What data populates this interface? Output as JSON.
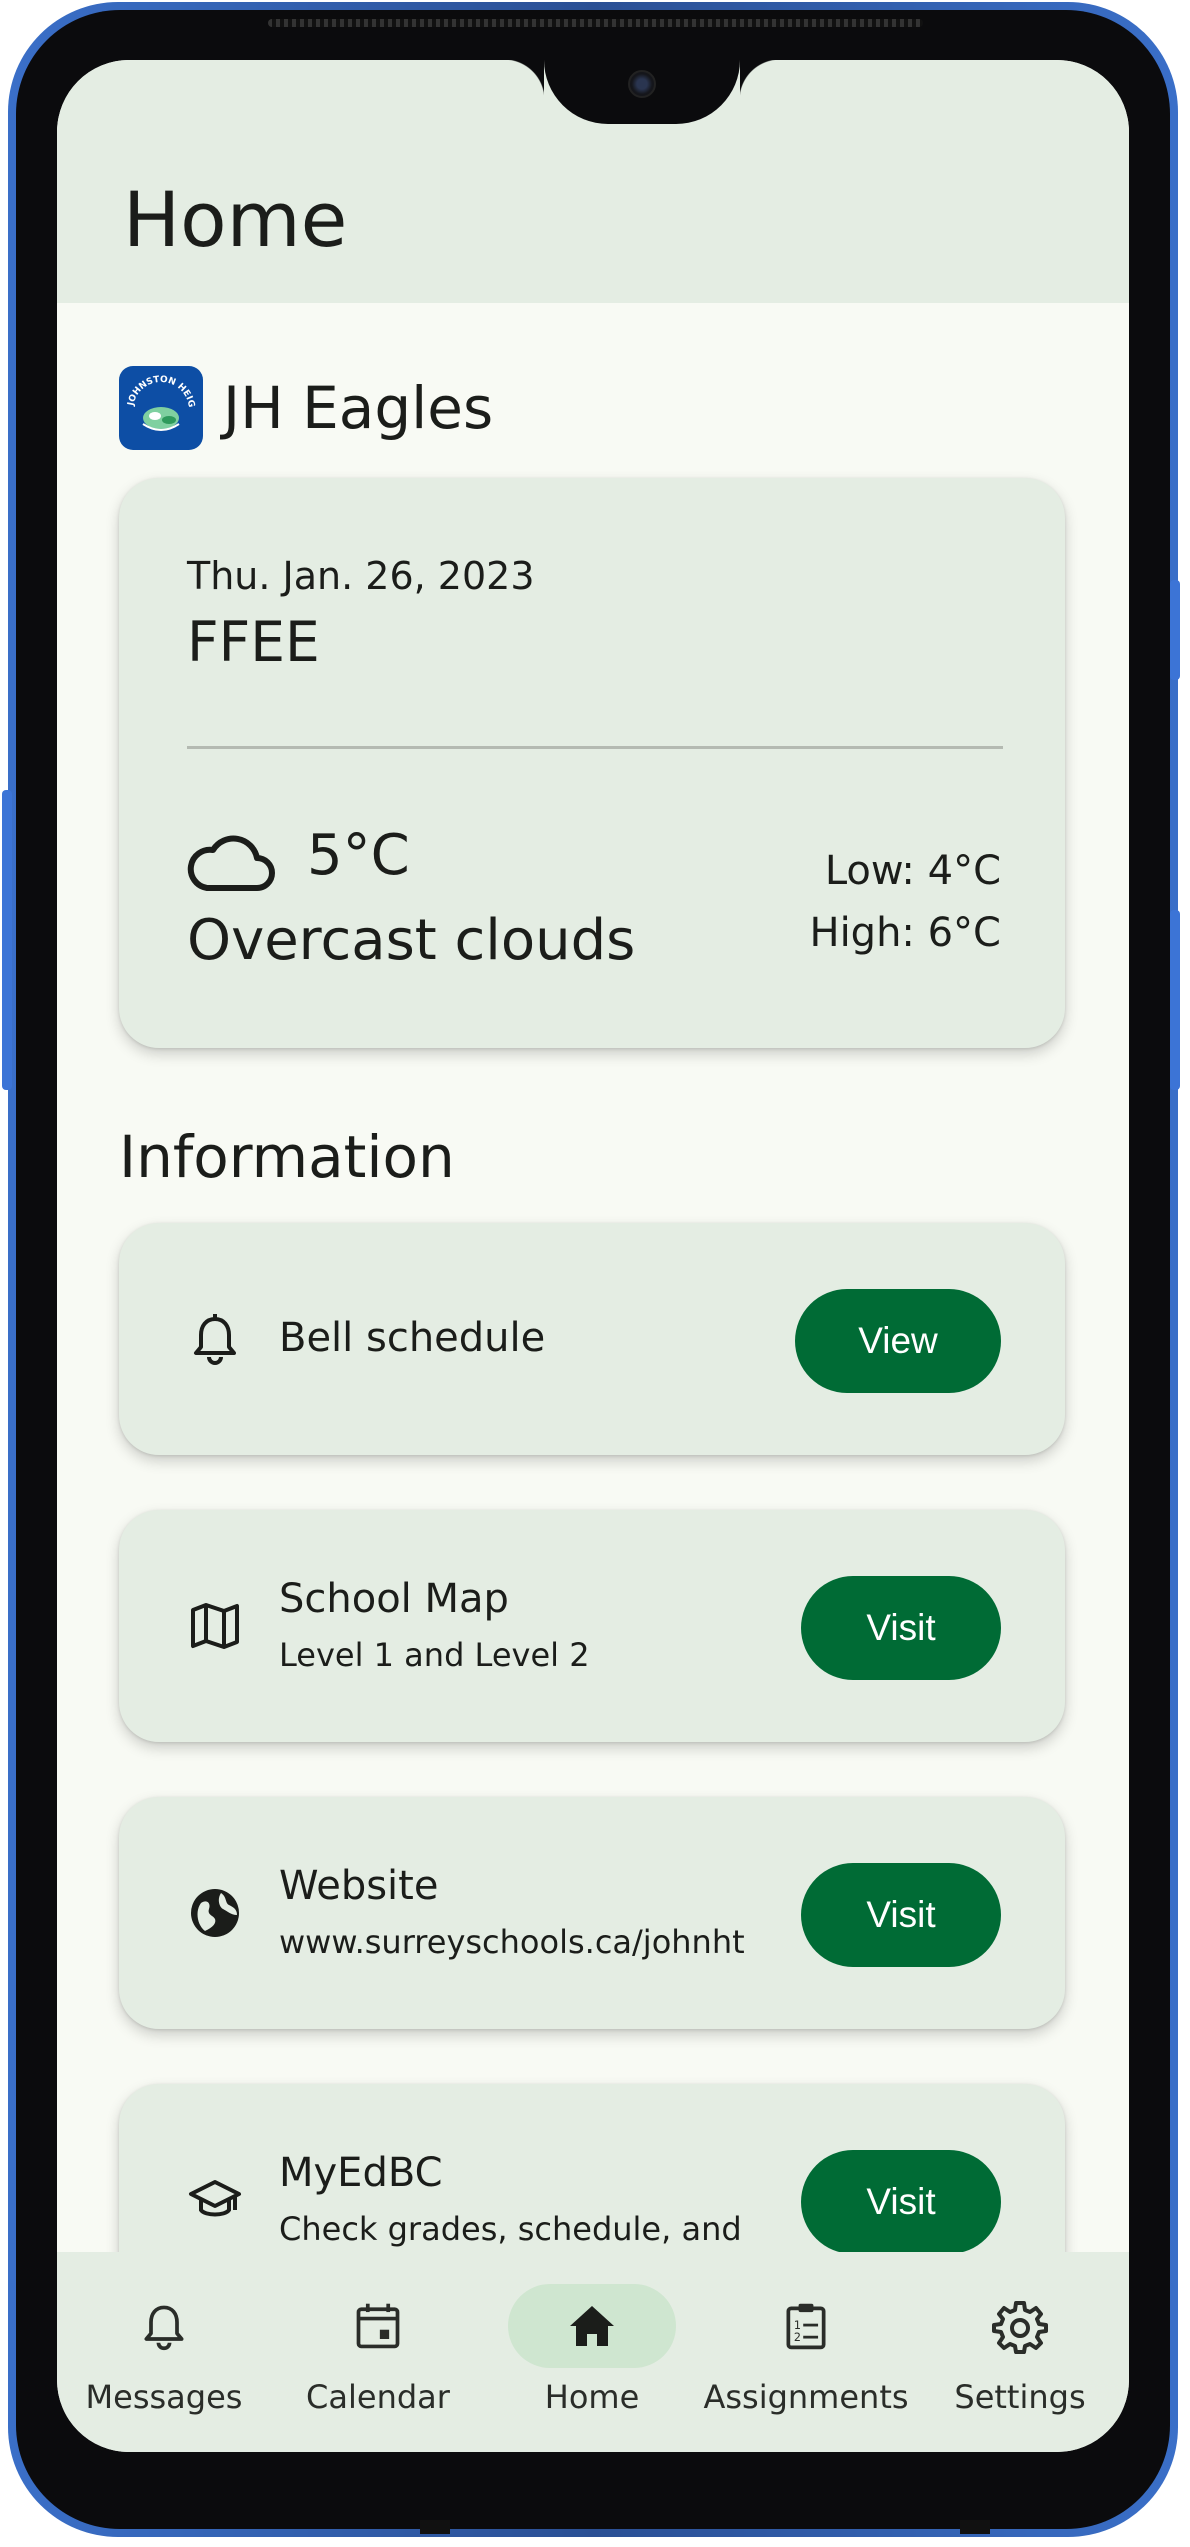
{
  "page": {
    "title": "Home"
  },
  "school": {
    "name": "JH Eagles",
    "logo_text": "JOHNSTON HEIGHTS"
  },
  "today": {
    "date": "Thu. Jan. 26, 2023",
    "code": "FFEE",
    "weather": {
      "icon": "cloud-icon",
      "temperature": "5°C",
      "condition": "Overcast clouds",
      "low": "Low: 4°C",
      "high": "High: 6°C"
    }
  },
  "information": {
    "title": "Information",
    "items": [
      {
        "icon": "bell-icon",
        "title": "Bell schedule",
        "subtitle": "",
        "action": "View"
      },
      {
        "icon": "map-icon",
        "title": "School Map",
        "subtitle": "Level 1 and Level 2",
        "action": "Visit"
      },
      {
        "icon": "globe-icon",
        "title": "Website",
        "subtitle": "www.surreyschools.ca/johnht",
        "action": "Visit"
      },
      {
        "icon": "graduation-cap-icon",
        "title": "MyEdBC",
        "subtitle": "Check grades, schedule, and",
        "action": "Visit"
      }
    ]
  },
  "nav": {
    "active": "Home",
    "items": [
      {
        "icon": "bell-icon",
        "label": "Messages"
      },
      {
        "icon": "calendar-icon",
        "label": "Calendar"
      },
      {
        "icon": "home-icon",
        "label": "Home"
      },
      {
        "icon": "clipboard-icon",
        "label": "Assignments"
      },
      {
        "icon": "gear-icon",
        "label": "Settings"
      }
    ]
  },
  "colors": {
    "surface": "#f8faf4",
    "card": "#e4ede3",
    "primary": "#006b35",
    "nav_active": "#cfe6d0",
    "text": "#1b1d1a"
  }
}
